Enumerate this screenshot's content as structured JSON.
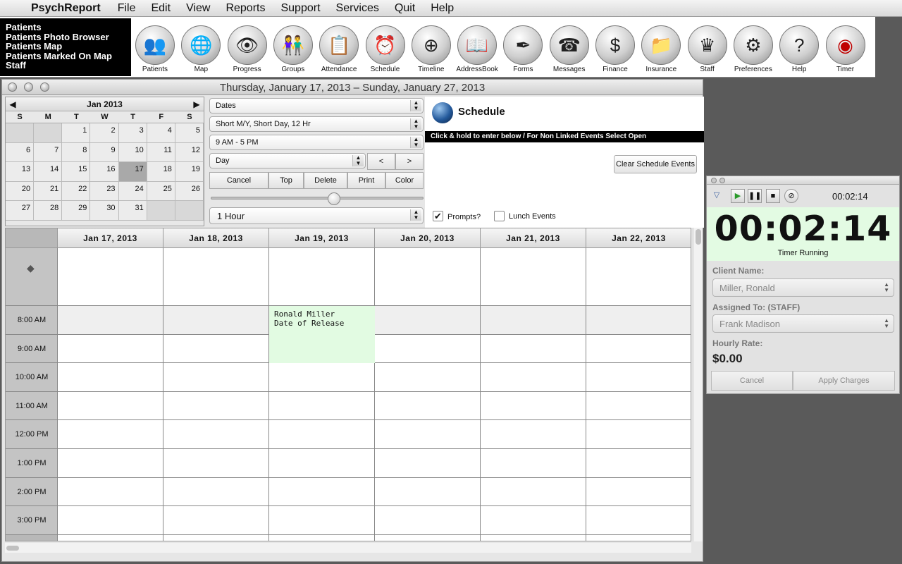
{
  "menubar": {
    "app_name": "PsychReport",
    "items": [
      "File",
      "Edit",
      "View",
      "Reports",
      "Support",
      "Services",
      "Quit",
      "Help"
    ]
  },
  "toolbar": {
    "links": [
      "Patients",
      "Patients Photo Browser",
      "Patients Map",
      "Patients Marked On Map",
      "Staff"
    ],
    "tools": [
      {
        "label": "Patients",
        "glyph": "👥"
      },
      {
        "label": "Map",
        "glyph": "🌐"
      },
      {
        "label": "Progress",
        "glyph": "👁"
      },
      {
        "label": "Groups",
        "glyph": "👫"
      },
      {
        "label": "Attendance",
        "glyph": "📋"
      },
      {
        "label": "Schedule",
        "glyph": "⏰"
      },
      {
        "label": "Timeline",
        "glyph": "⊕"
      },
      {
        "label": "AddressBook",
        "glyph": "📖"
      },
      {
        "label": "Forms",
        "glyph": "✒"
      },
      {
        "label": "Messages",
        "glyph": "☎"
      },
      {
        "label": "Finance",
        "glyph": "$"
      },
      {
        "label": "Insurance",
        "glyph": "📁"
      },
      {
        "label": "Staff",
        "glyph": "♛"
      },
      {
        "label": "Preferences",
        "glyph": "⚙"
      },
      {
        "label": "Help",
        "glyph": "?"
      },
      {
        "label": "Timer",
        "glyph": "◉"
      }
    ]
  },
  "window": {
    "title": "Thursday, January 17, 2013 – Sunday, January 27, 2013"
  },
  "calendar": {
    "month_label": "Jan 2013",
    "prev": "◀",
    "next": "▶",
    "dow": [
      "S",
      "M",
      "T",
      "W",
      "T",
      "F",
      "S"
    ],
    "weeks": [
      [
        "",
        "",
        "1",
        "2",
        "3",
        "4",
        "5"
      ],
      [
        "6",
        "7",
        "8",
        "9",
        "10",
        "11",
        "12"
      ],
      [
        "13",
        "14",
        "15",
        "16",
        "17",
        "18",
        "19"
      ],
      [
        "20",
        "21",
        "22",
        "23",
        "24",
        "25",
        "26"
      ],
      [
        "27",
        "28",
        "29",
        "30",
        "31",
        "",
        ""
      ]
    ],
    "selected": "17"
  },
  "controls": {
    "dates_select": "Dates",
    "format_select": "Short M/Y, Short Day, 12  Hr",
    "hours_select": "9 AM - 5 PM",
    "view_select": "Day",
    "prev_btn": "<",
    "next_btn": ">",
    "buttons": [
      "Cancel",
      "Top",
      "Delete",
      "Print",
      "Color"
    ],
    "interval_select": "1 Hour",
    "slider_fraction": 0.58,
    "prompts_label": "Prompts?",
    "prompts_checked": true,
    "lunch_label": "Lunch Events",
    "lunch_checked": false
  },
  "schedule_panel": {
    "title": "Schedule",
    "hint": "Click & hold to enter below /   For Non Linked Events Select Open",
    "clear_button": "Clear Schedule Events"
  },
  "grid": {
    "allday_marker": "◆",
    "days": [
      "Jan 17, 2013",
      "Jan 18, 2013",
      "Jan 19, 2013",
      "Jan 20, 2013",
      "Jan 21, 2013",
      "Jan 22, 2013"
    ],
    "times": [
      "8:00 AM",
      "9:00 AM",
      "10:00 AM",
      "11:00 AM",
      "12:00 PM",
      "1:00 PM",
      "2:00 PM",
      "3:00 PM"
    ],
    "event": {
      "line1": "Ronald Miller",
      "line2": "Date of Release",
      "color": "#e2fbe2"
    }
  },
  "timer": {
    "small_time": "00:02:14",
    "big_time": "00:02:14",
    "status": "Timer Running",
    "client_label": "Client Name:",
    "client_value": "Miller, Ronald",
    "assigned_label": "Assigned To:   (STAFF)",
    "assigned_value": "Frank Madison",
    "rate_label": "Hourly Rate:",
    "rate_value": "$0.00",
    "cancel_btn": "Cancel",
    "apply_btn": "Apply Charges"
  }
}
